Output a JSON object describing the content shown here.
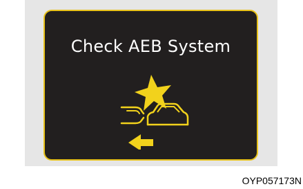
{
  "display": {
    "message": "Check AEB System",
    "accent_color": "#e8c21a",
    "icon": "aeb-collision-warning-icon"
  },
  "figure_code": "OYP057173N"
}
